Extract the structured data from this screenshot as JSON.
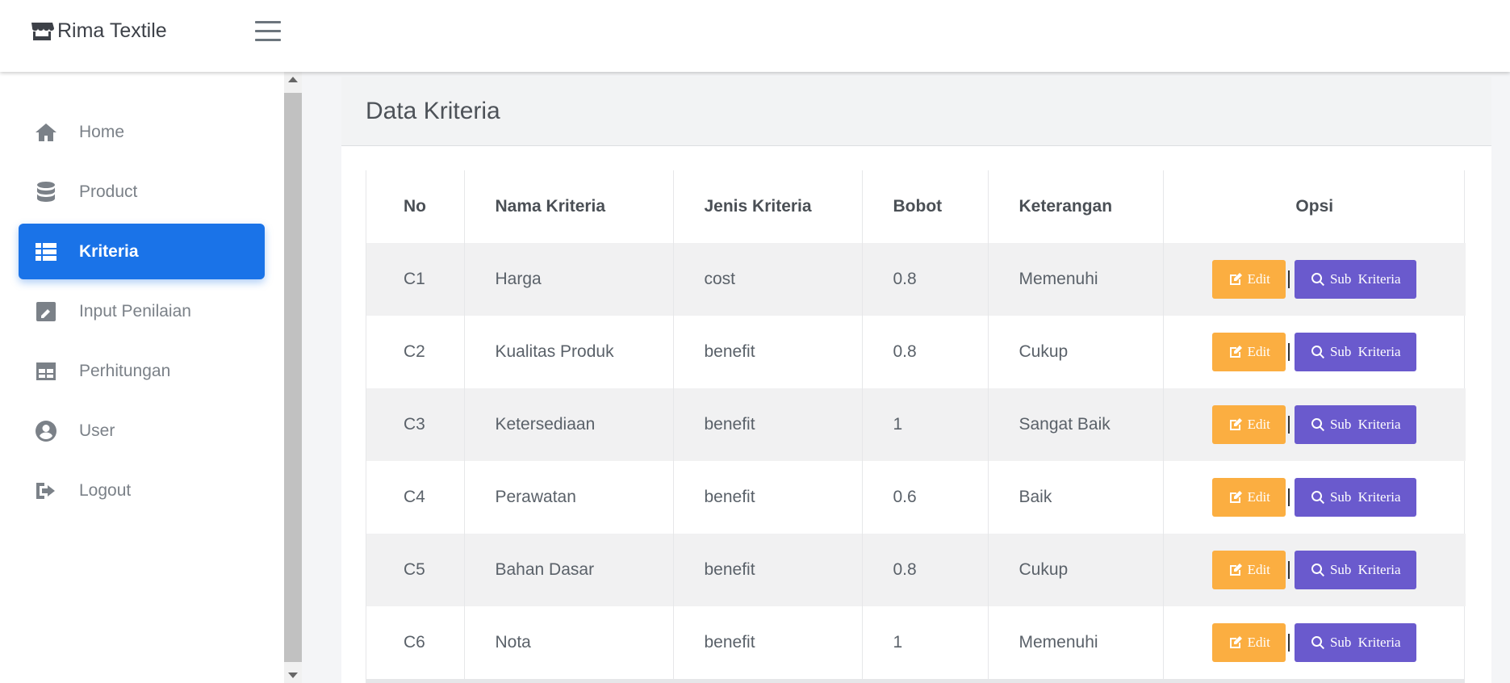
{
  "brand": {
    "name": "Rima Textile",
    "icon": "store-icon"
  },
  "sidebar": {
    "items": [
      {
        "label": "Home",
        "icon": "home-icon",
        "active": false
      },
      {
        "label": "Product",
        "icon": "database-icon",
        "active": false
      },
      {
        "label": "Kriteria",
        "icon": "table-list-icon",
        "active": true
      },
      {
        "label": "Input Penilaian",
        "icon": "edit-square-icon",
        "active": false
      },
      {
        "label": "Perhitungan",
        "icon": "grid-table-icon",
        "active": false
      },
      {
        "label": "User",
        "icon": "user-circle-icon",
        "active": false
      },
      {
        "label": "Logout",
        "icon": "logout-icon",
        "active": false
      }
    ]
  },
  "page": {
    "title": "Data Kriteria"
  },
  "table": {
    "headers": [
      "No",
      "Nama Kriteria",
      "Jenis Kriteria",
      "Bobot",
      "Keterangan",
      "Opsi"
    ],
    "rows": [
      {
        "no": "C1",
        "nama": "Harga",
        "jenis": "cost",
        "bobot": "0.8",
        "keterangan": "Memenuhi"
      },
      {
        "no": "C2",
        "nama": "Kualitas Produk",
        "jenis": "benefit",
        "bobot": "0.8",
        "keterangan": "Cukup"
      },
      {
        "no": "C3",
        "nama": "Ketersediaan",
        "jenis": "benefit",
        "bobot": "1",
        "keterangan": "Sangat Baik"
      },
      {
        "no": "C4",
        "nama": "Perawatan",
        "jenis": "benefit",
        "bobot": "0.6",
        "keterangan": "Baik"
      },
      {
        "no": "C5",
        "nama": "Bahan Dasar",
        "jenis": "benefit",
        "bobot": "0.8",
        "keterangan": "Cukup"
      },
      {
        "no": "C6",
        "nama": "Nota",
        "jenis": "benefit",
        "bobot": "1",
        "keterangan": "Memenuhi"
      }
    ],
    "edit_label": "Edit",
    "sub_label": "Sub Kriteria",
    "separator": "|"
  },
  "colors": {
    "primary": "#1a73e8",
    "edit": "#fbae41",
    "sub_kriteria": "#6a5acd"
  }
}
